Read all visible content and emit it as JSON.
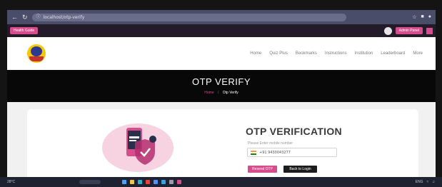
{
  "browser": {
    "url": "localhost/otp-verify",
    "nav_icons": [
      "back-icon",
      "reload-icon",
      "info-icon"
    ],
    "right_icons": [
      "bookmark-icon",
      "extension-icon",
      "profile-icon"
    ]
  },
  "topbar": {
    "left_label": "Health Guide",
    "right_label": "Admin Panel"
  },
  "nav": {
    "items": [
      "Home",
      "Quiz Plus",
      "Bookmarks",
      "Instructions",
      "Institution",
      "Leaderboard",
      "More"
    ]
  },
  "hero": {
    "title": "OTP VERIFY",
    "breadcrumb_home": "Home",
    "breadcrumb_sep": "/",
    "breadcrumb_current": "Otp Verify"
  },
  "form": {
    "title": "OTP VERIFICATION",
    "subtitle": "Please Enter mobile number",
    "phone_value": "+91 9430043277",
    "resend_label": "Resend OTP",
    "back_label": "Back to Login"
  },
  "taskbar": {
    "left_text": "28°C",
    "right_text": "ENG"
  },
  "colors": {
    "accent": "#d64c8c",
    "hero_bg": "#080808",
    "chrome_bg": "#4a4d6a"
  }
}
